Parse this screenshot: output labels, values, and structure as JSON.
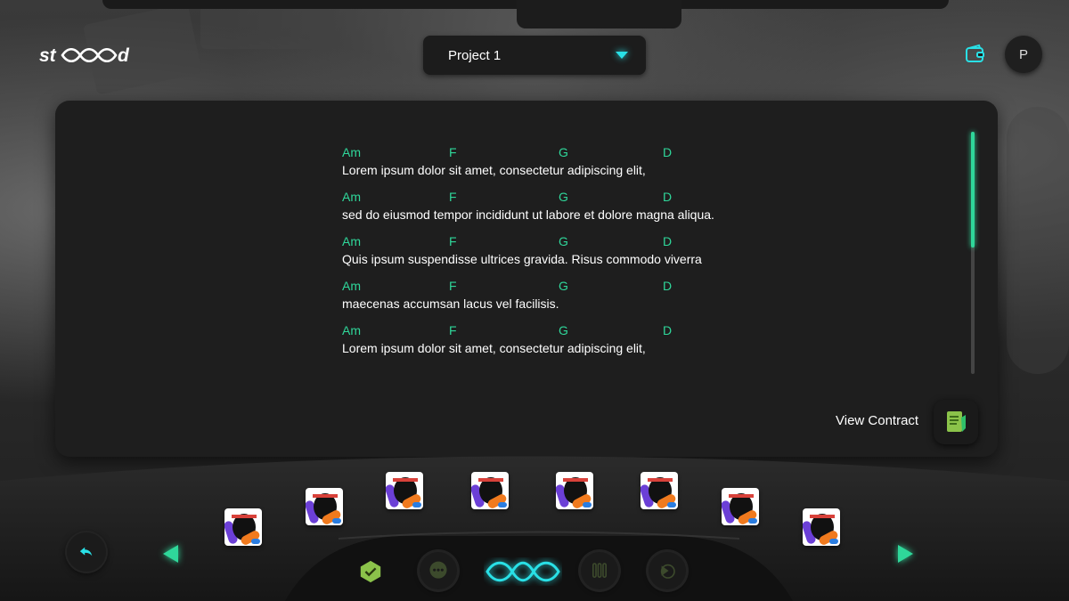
{
  "app": {
    "logo_text": "stood"
  },
  "header": {
    "project_select": {
      "selected": "Project 1"
    },
    "avatar_initial": "P"
  },
  "lyrics": [
    {
      "chords": [
        "Am",
        "F",
        "G",
        "D"
      ],
      "text": "Lorem ipsum dolor sit amet, consectetur adipiscing elit,"
    },
    {
      "chords": [
        "Am",
        "F",
        "G",
        "D"
      ],
      "text": "sed do eiusmod tempor incididunt ut labore et dolore magna aliqua."
    },
    {
      "chords": [
        "Am",
        "F",
        "G",
        "D"
      ],
      "text": "Quis ipsum suspendisse ultrices gravida. Risus commodo viverra"
    },
    {
      "chords": [
        "Am",
        "F",
        "G",
        "D"
      ],
      "text": "maecenas accumsan lacus vel facilisis."
    },
    {
      "chords": [
        "Am",
        "F",
        "G",
        "D"
      ],
      "text": "Lorem ipsum dolor sit amet, consectetur adipiscing elit,"
    }
  ],
  "panel": {
    "view_contract_label": "View Contract"
  },
  "colors": {
    "accent": "#2fd79a",
    "cyan": "#29e0e6",
    "panel_bg": "#1e1e1e"
  },
  "icons": {
    "wallet": "wallet-icon",
    "contract": "document-icon",
    "back": "reply-icon",
    "tasks": "hexagon-check-icon",
    "chat": "chat-bubble-icon",
    "home": "infinity-icon",
    "tools": "test-tubes-icon",
    "media": "play-circle-icon"
  }
}
